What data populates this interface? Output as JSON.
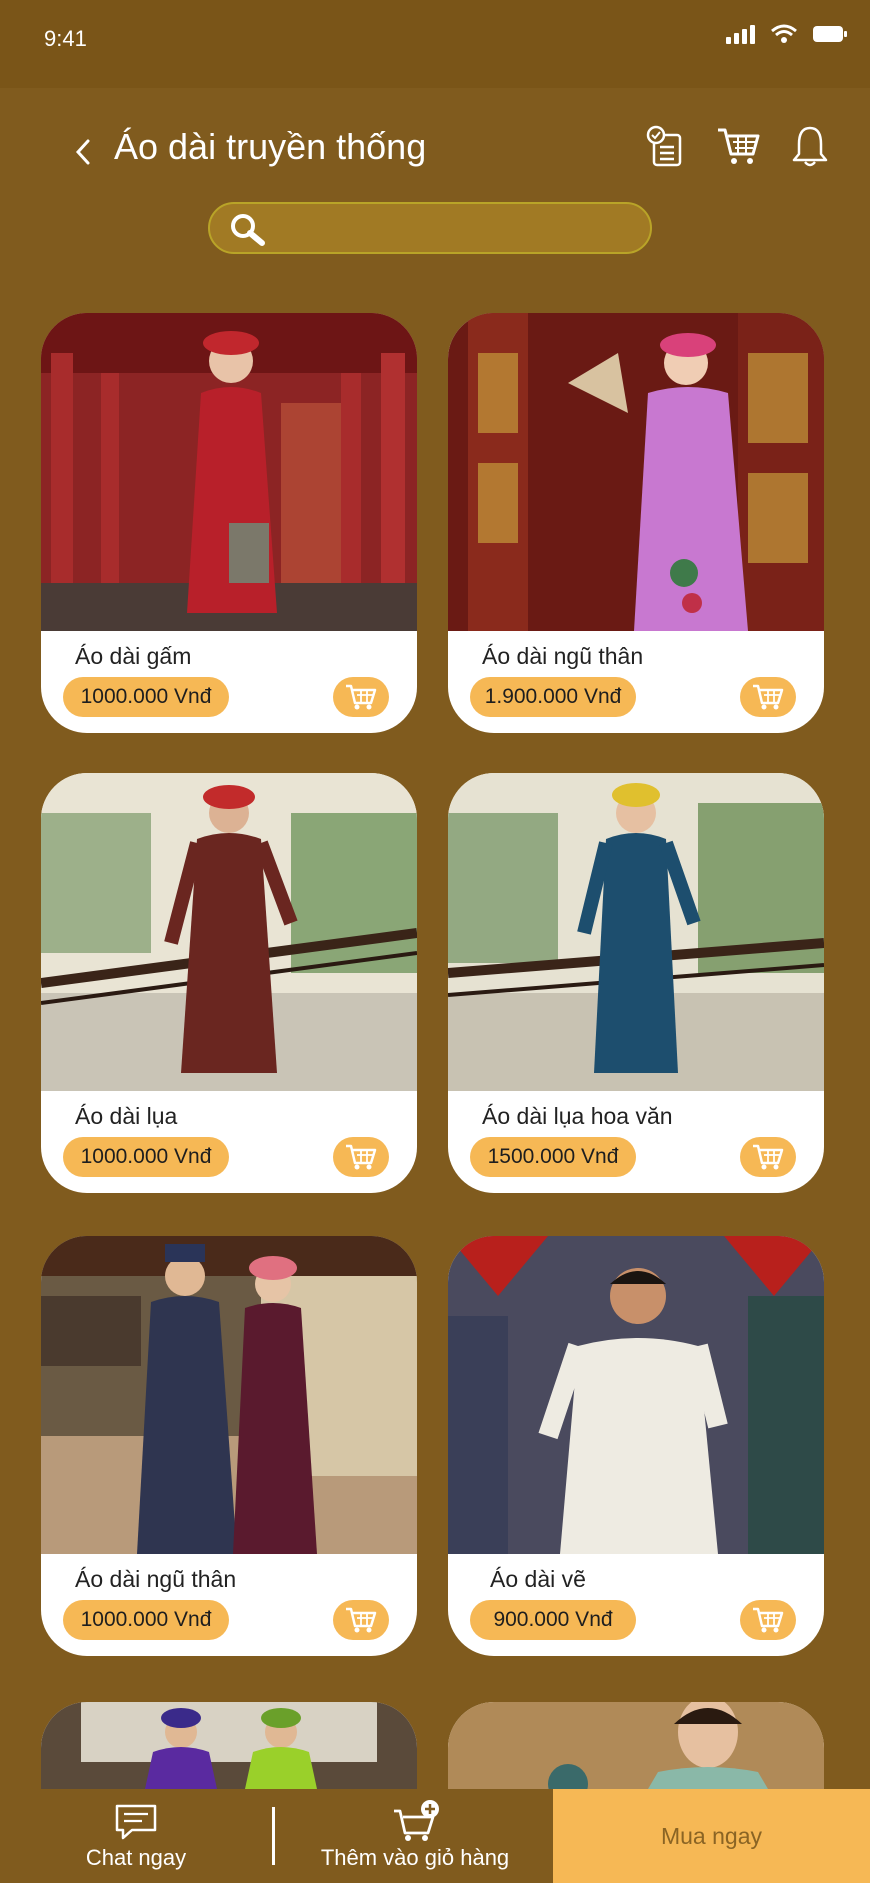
{
  "status": {
    "time": "9:41"
  },
  "header": {
    "title": "Áo dài truyền thống"
  },
  "search": {
    "placeholder": ""
  },
  "products": [
    {
      "name": "Áo dài gấm",
      "price": "1000.000 Vnđ"
    },
    {
      "name": "Áo dài ngũ thân",
      "price": "1.900.000 Vnđ"
    },
    {
      "name": "Áo dài lụa",
      "price": "1000.000 Vnđ"
    },
    {
      "name": "Áo dài lụa hoa văn",
      "price": "1500.000 Vnđ"
    },
    {
      "name": "Áo dài ngũ thân",
      "price": "1000.000 Vnđ"
    },
    {
      "name": "Áo dài vẽ",
      "price": "900.000 Vnđ"
    }
  ],
  "bottom": {
    "chat": "Chat ngay",
    "add_to_cart": "Thêm vào giỏ hàng",
    "buy_now": "Mua ngay"
  },
  "colors": {
    "background": "#805b1e",
    "accent": "#f6b855",
    "search_border": "#b9a428"
  },
  "icons": [
    "back-icon",
    "order-list-icon",
    "cart-icon",
    "bell-icon",
    "search-icon",
    "add-to-cart-icon",
    "chat-icon",
    "cart-plus-icon"
  ]
}
